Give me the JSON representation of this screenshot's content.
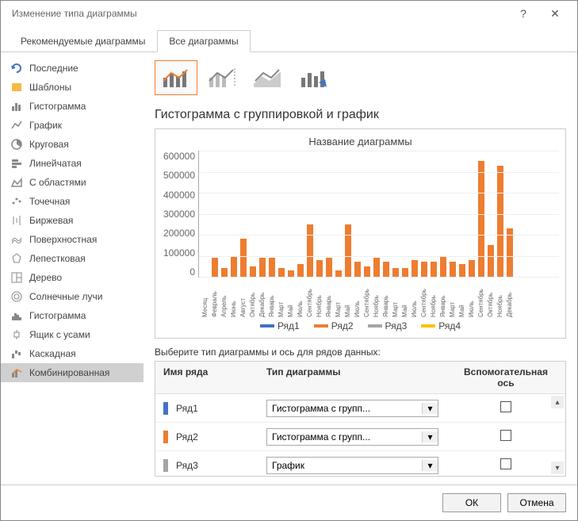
{
  "window": {
    "title": "Изменение типа диаграммы"
  },
  "tabs": {
    "recommended": "Рекомендуемые диаграммы",
    "all": "Все диаграммы"
  },
  "sidebar": {
    "items": [
      {
        "label": "Последние"
      },
      {
        "label": "Шаблоны"
      },
      {
        "label": "Гистограмма"
      },
      {
        "label": "График"
      },
      {
        "label": "Круговая"
      },
      {
        "label": "Линейчатая"
      },
      {
        "label": "С областями"
      },
      {
        "label": "Точечная"
      },
      {
        "label": "Биржевая"
      },
      {
        "label": "Поверхностная"
      },
      {
        "label": "Лепестковая"
      },
      {
        "label": "Дерево"
      },
      {
        "label": "Солнечные лучи"
      },
      {
        "label": "Гистограмма"
      },
      {
        "label": "Ящик с усами"
      },
      {
        "label": "Каскадная"
      },
      {
        "label": "Комбинированная"
      }
    ]
  },
  "main": {
    "heading": "Гистограмма с группировкой и график",
    "chart_title": "Название диаграммы",
    "series_prompt": "Выберите тип диаграммы и ось для рядов данных:",
    "columns": {
      "name": "Имя ряда",
      "type": "Тип диаграммы",
      "aux": "Вспомогательная ось"
    },
    "rows": [
      {
        "name": "Ряд1",
        "type": "Гистограмма с групп...",
        "color": "#4472c4"
      },
      {
        "name": "Ряд2",
        "type": "Гистограмма с групп...",
        "color": "#ed7d31"
      },
      {
        "name": "Ряд3",
        "type": "График",
        "color": "#a5a5a5"
      }
    ]
  },
  "legend": {
    "r1": "Ряд1",
    "r2": "Ряд2",
    "r3": "Ряд3",
    "r4": "Ряд4"
  },
  "footer": {
    "ok": "ОК",
    "cancel": "Отмена"
  },
  "chart_data": {
    "type": "bar",
    "title": "Название диаграммы",
    "ylabel": "",
    "ylim": [
      0,
      600000
    ],
    "yticks": [
      0,
      100000,
      200000,
      300000,
      400000,
      500000,
      600000
    ],
    "categories": [
      "Месяц",
      "Февраль",
      "Апрель",
      "Июнь",
      "Август",
      "Октябрь",
      "Декабрь",
      "Январь",
      "Март",
      "Май",
      "Июль",
      "Сентябрь",
      "Ноябрь",
      "Январь",
      "Март",
      "Май",
      "Июль",
      "Сентябрь",
      "Ноябрь",
      "Январь",
      "Март",
      "Май",
      "Июль",
      "Сентябрь",
      "Ноябрь",
      "Январь",
      "Март",
      "Май",
      "Июль",
      "Сентябрь",
      "Октябрь",
      "Ноябрь",
      "Декабрь"
    ],
    "series": [
      {
        "name": "Ряд2",
        "color": "#ed7d31",
        "values": [
          0,
          90000,
          40000,
          100000,
          180000,
          50000,
          90000,
          90000,
          40000,
          30000,
          60000,
          250000,
          80000,
          90000,
          30000,
          250000,
          70000,
          50000,
          90000,
          70000,
          40000,
          40000,
          80000,
          70000,
          70000,
          100000,
          70000,
          60000,
          80000,
          550000,
          150000,
          530000,
          230000
        ]
      }
    ],
    "legend": [
      "Ряд1",
      "Ряд2",
      "Ряд3",
      "Ряд4"
    ]
  }
}
